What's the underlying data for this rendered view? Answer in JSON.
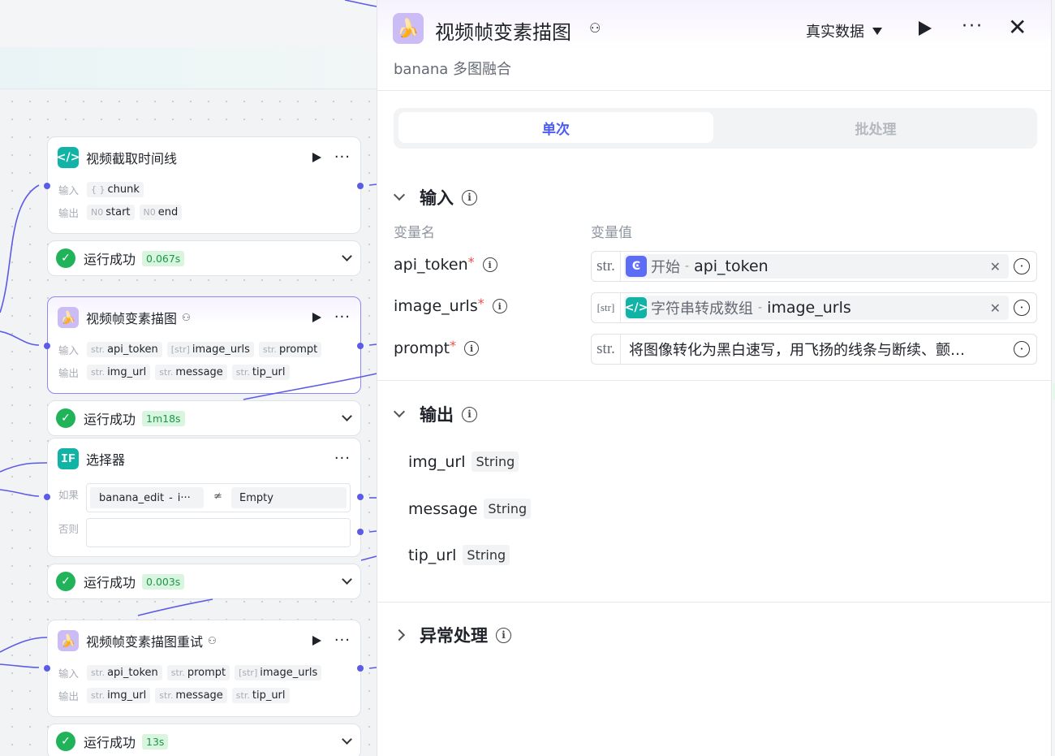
{
  "canvas": {
    "nodes": [
      {
        "title": "视频截取时间线",
        "icon": "code-icon",
        "input_label": "输入",
        "output_label": "输出",
        "inputs": [
          {
            "type": "{ }",
            "name": "chunk"
          }
        ],
        "outputs": [
          {
            "type": "N0",
            "name": "start"
          },
          {
            "type": "N0",
            "name": "end"
          }
        ]
      },
      {
        "title": "视频帧变素描图",
        "icon": "banana-icon",
        "input_label": "输入",
        "output_label": "输出",
        "inputs": [
          {
            "type": "str.",
            "name": "api_token"
          },
          {
            "type": "[str]",
            "name": "image_urls"
          },
          {
            "type": "str.",
            "name": "prompt"
          }
        ],
        "outputs": [
          {
            "type": "str.",
            "name": "img_url"
          },
          {
            "type": "str.",
            "name": "message"
          },
          {
            "type": "str.",
            "name": "tip_url"
          }
        ]
      },
      {
        "title": "选择器",
        "icon": "if-icon",
        "if_label": "如果",
        "else_label": "否则",
        "condition": {
          "left": "banana_edit",
          "sep": "-",
          "left_more": "i···",
          "op": "≄",
          "right": "Empty"
        }
      },
      {
        "title": "视频帧变素描图重试",
        "icon": "banana-icon",
        "input_label": "输入",
        "output_label": "输出",
        "inputs": [
          {
            "type": "str.",
            "name": "api_token"
          },
          {
            "type": "str.",
            "name": "prompt"
          },
          {
            "type": "[str]",
            "name": "image_urls"
          }
        ],
        "outputs": [
          {
            "type": "str.",
            "name": "img_url"
          },
          {
            "type": "str.",
            "name": "message"
          },
          {
            "type": "str.",
            "name": "tip_url"
          }
        ]
      }
    ],
    "runs": [
      {
        "status": "运行成功",
        "time": "0.067s"
      },
      {
        "status": "运行成功",
        "time": "1m18s"
      },
      {
        "status": "运行成功",
        "time": "0.003s"
      },
      {
        "status": "运行成功",
        "time": "13s"
      }
    ]
  },
  "panel": {
    "title": "视频帧变素描图",
    "subtitle": "banana 多图融合",
    "data_mode": "真实数据",
    "tabs": {
      "single": "单次",
      "batch": "批处理"
    },
    "input_section": {
      "title": "输入",
      "col_name": "变量名",
      "col_value": "变量值",
      "params": [
        {
          "name": "api_token",
          "type": "str.",
          "ref_node": "开始",
          "ref_var": "api_token",
          "ref_icon": "start-icon"
        },
        {
          "name": "image_urls",
          "type": "[str]",
          "ref_node": "字符串转成数组",
          "ref_var": "image_urls",
          "ref_icon": "code-icon"
        },
        {
          "name": "prompt",
          "type": "str.",
          "value": "将图像转化为黑白速写，用飞扬的线条与断续、颤…"
        }
      ]
    },
    "output_section": {
      "title": "输出",
      "vars": [
        {
          "name": "img_url",
          "type": "String"
        },
        {
          "name": "message",
          "type": "String"
        },
        {
          "name": "tip_url",
          "type": "String"
        }
      ]
    },
    "error_section": {
      "title": "异常处理"
    }
  },
  "colors": {
    "accent": "#4c5bf5",
    "success": "#21b35a",
    "edge": "#5b5be6",
    "code": "#10b3a6",
    "banana": "#cbbcf5"
  }
}
